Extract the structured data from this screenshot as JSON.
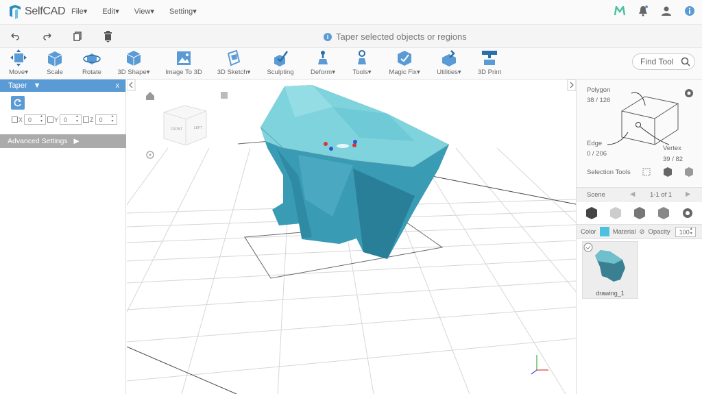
{
  "app": {
    "name": "SelfCAD"
  },
  "menu": [
    "File",
    "Edit",
    "View",
    "Setting"
  ],
  "hint": "Taper selected objects or regions",
  "toolbar": [
    {
      "label": "Move",
      "dropdown": true
    },
    {
      "label": "Scale"
    },
    {
      "label": "Rotate"
    },
    {
      "label": "3D Shape",
      "dropdown": true
    },
    {
      "label": "Image To 3D"
    },
    {
      "label": "3D Sketch",
      "dropdown": true
    },
    {
      "label": "Sculpting"
    },
    {
      "label": "Deform",
      "dropdown": true
    },
    {
      "label": "Tools",
      "dropdown": true
    },
    {
      "label": "Magic Fix",
      "dropdown": true
    },
    {
      "label": "Utilities",
      "dropdown": true
    },
    {
      "label": "3D Print"
    }
  ],
  "find_tool": {
    "placeholder": "Find Tool"
  },
  "left_panel": {
    "title": "Taper",
    "close": "x",
    "axes": [
      {
        "label": "X",
        "value": "0"
      },
      {
        "label": "Y",
        "value": "0"
      },
      {
        "label": "Z",
        "value": "0"
      }
    ],
    "advanced": "Advanced Settings"
  },
  "view_cube": {
    "front": "FRONT",
    "left": "LEFT"
  },
  "selection": {
    "polygon_label": "Polygon",
    "polygon_count": "38 / 126",
    "edge_label": "Edge",
    "edge_count": "0 / 206",
    "vertex_label": "Vertex",
    "vertex_count": "39 / 82",
    "tools_label": "Selection Tools"
  },
  "scene": {
    "label": "Scene",
    "pages": "1-1 of 1"
  },
  "props": {
    "color_label": "Color",
    "material_label": "Material",
    "opacity_label": "Opacity",
    "opacity_value": "100",
    "color": "#4fc1e0"
  },
  "objects": [
    {
      "name": "drawing_1"
    }
  ],
  "colors": {
    "accent": "#5b9bd5",
    "model_top": "#7fd3dd",
    "model_side": "#3a9bb5"
  },
  "icons": [
    "undo-icon",
    "redo-icon",
    "copy-icon",
    "trash-icon",
    "bell-icon",
    "user-icon",
    "info-icon",
    "search-icon",
    "gear-icon",
    "home-icon"
  ]
}
